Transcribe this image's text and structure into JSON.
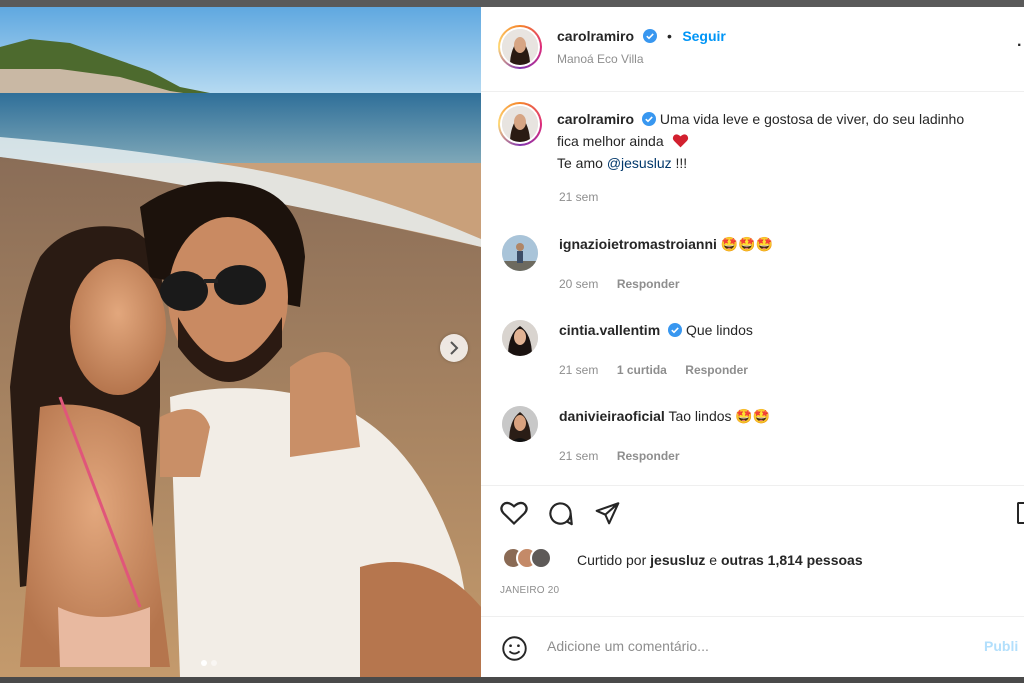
{
  "post": {
    "username": "carolramiro",
    "follow_label": "Seguir",
    "separator": "•",
    "location": "Manoá Eco Villa",
    "caption_line1": "Uma vida leve e gostosa de viver, do seu ladinho",
    "caption_line2": "fica melhor ainda",
    "caption_line3_prefix": "Te amo ",
    "caption_mention": "@jesusluz",
    "caption_line3_suffix": " !!!",
    "caption_time": "21 sem"
  },
  "comments": [
    {
      "username": "ignazioietromastroianni",
      "text": "🤩🤩🤩",
      "time": "20 sem",
      "reply": "Responder",
      "likes": ""
    },
    {
      "username": "cintia.vallentim",
      "text": "Que lindos",
      "time": "21 sem",
      "likes": "1 curtida",
      "reply": "Responder"
    },
    {
      "username": "danivieiraoficial",
      "text": "Tao lindos 🤩🤩",
      "time": "21 sem",
      "reply": "Responder",
      "likes": ""
    }
  ],
  "likes": {
    "prefix": "Curtido por ",
    "user": "jesusluz",
    "middle": " e ",
    "others": "outras 1,814 pessoas"
  },
  "date": "JANEIRO 20",
  "comment_box": {
    "placeholder": "Adicione um comentário...",
    "publish": "Publi"
  },
  "icons": {
    "like": "heart-icon",
    "comment": "comment-bubble-icon",
    "share": "paper-plane-icon",
    "next": "chevron-right-icon",
    "emoji": "smiley-icon",
    "verified": "verified-badge-icon"
  },
  "colors": {
    "accent": "#0095f6",
    "verified": "#3897f0",
    "heart": "#ed4956"
  }
}
